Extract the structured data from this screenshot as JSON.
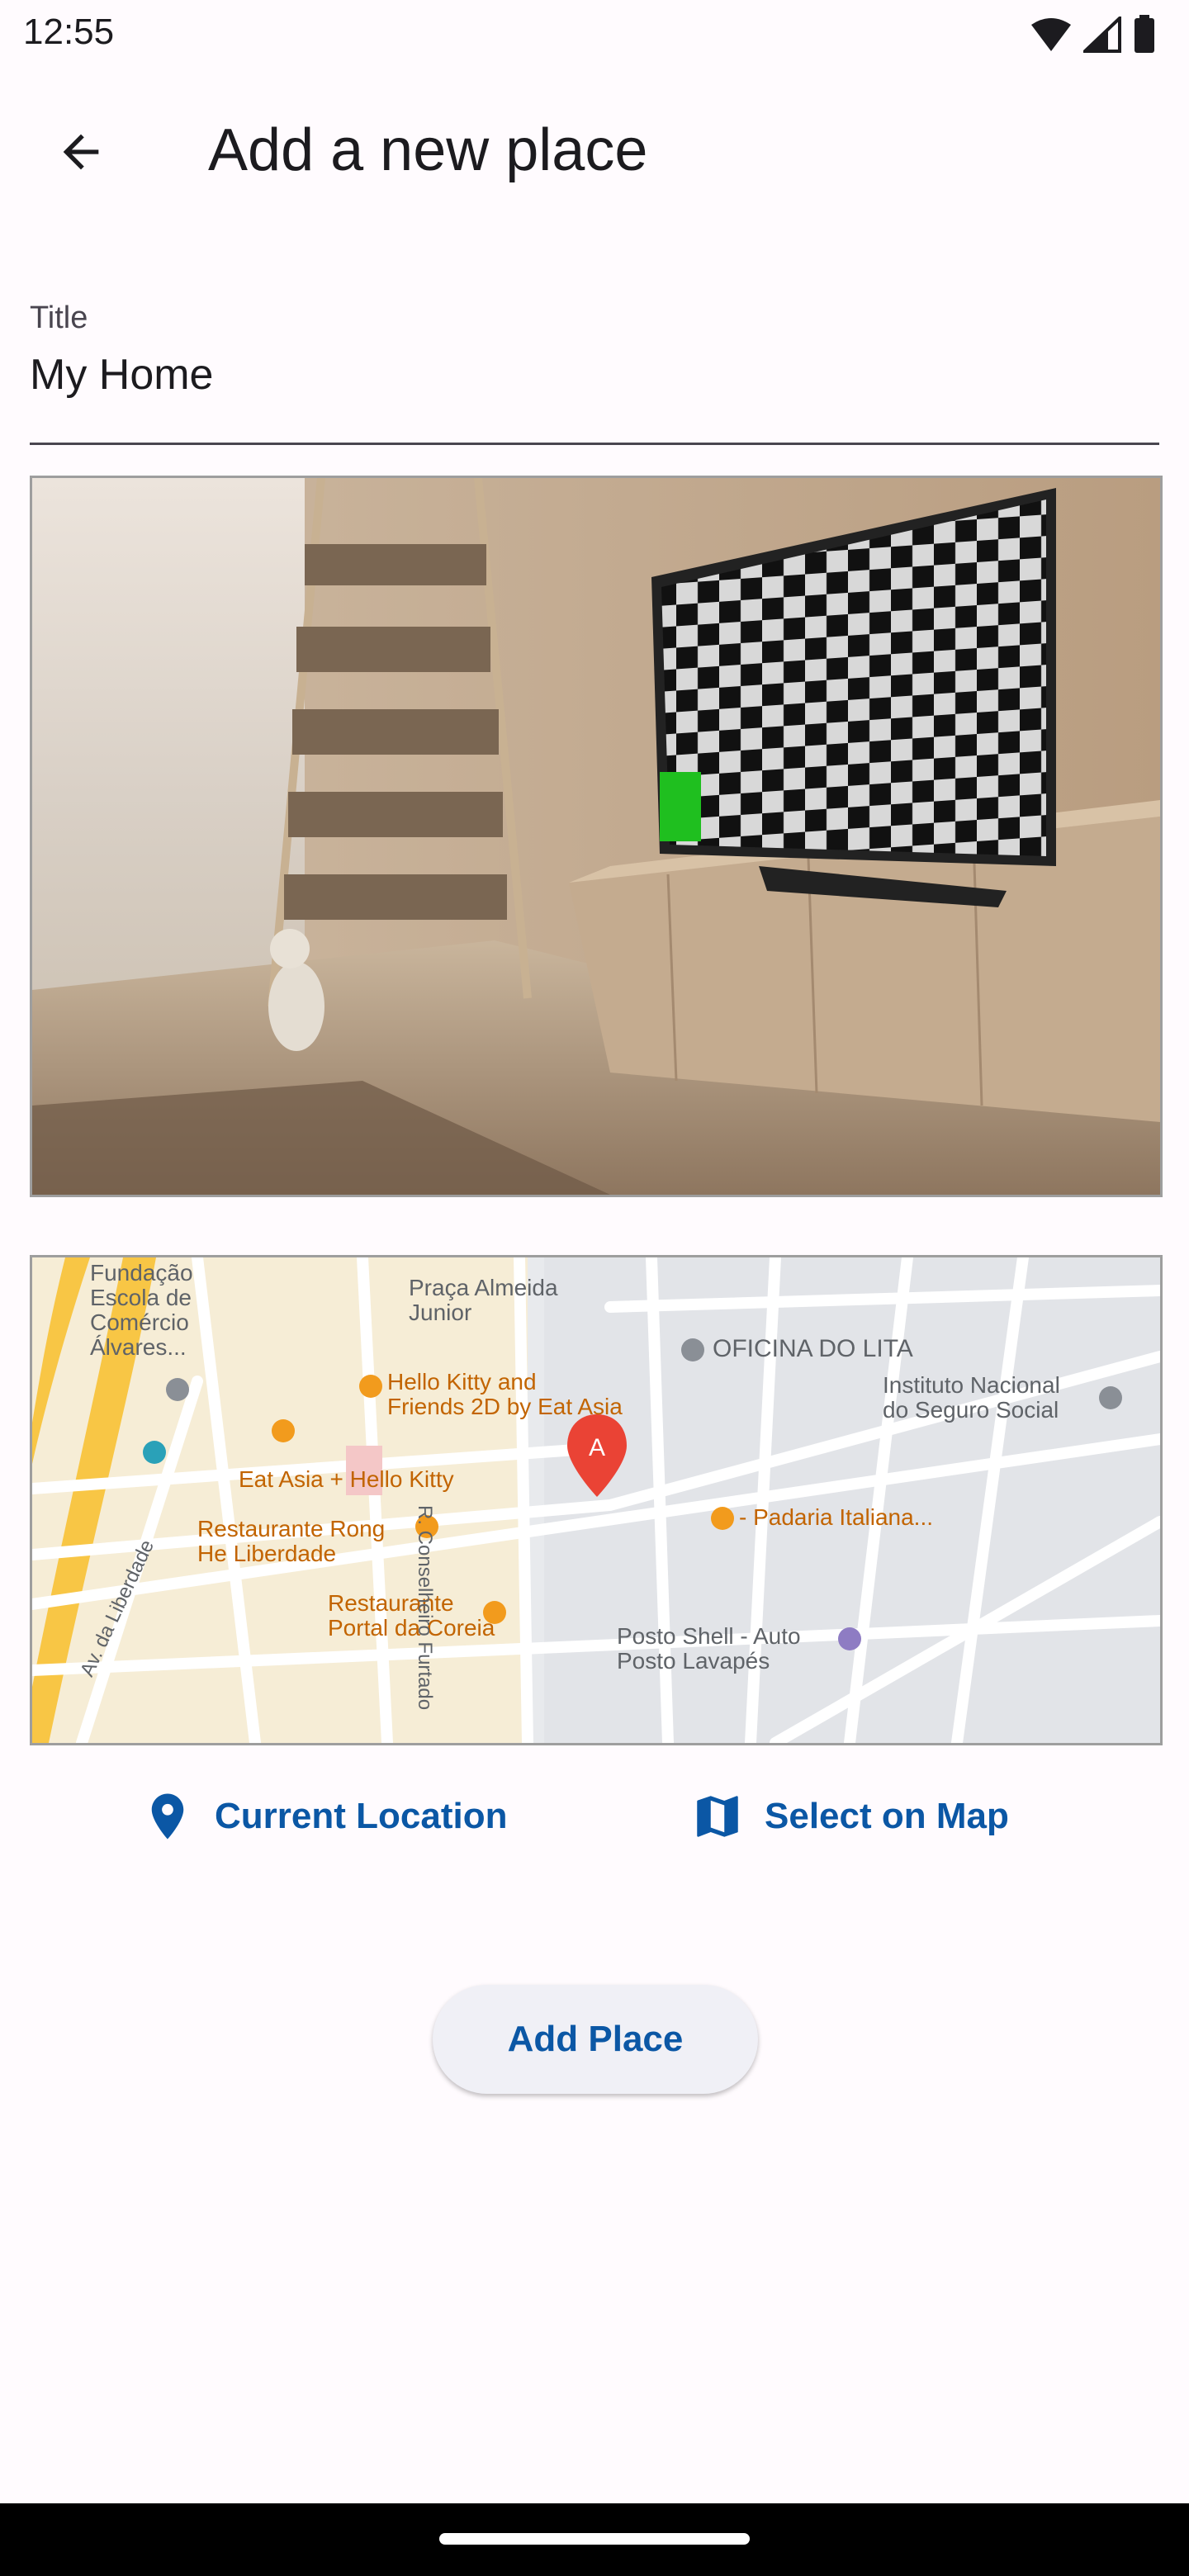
{
  "status_bar": {
    "time": "12:55"
  },
  "app_bar": {
    "title": "Add a new place"
  },
  "form": {
    "title_label": "Title",
    "title_value": "My Home"
  },
  "map": {
    "labels": {
      "fundacao": "Fundação\nEscola de\nComércio\nÁlvares...",
      "praca": "Praça Almeida\nJunior",
      "oficina": "OFICINA DO LITA",
      "hello_kitty": "Hello Kitty and\nFriends 2D by Eat Asia",
      "instituto": "Instituto Nacional\ndo Seguro Social",
      "eat_asia": "Eat Asia + Hello Kitty",
      "rong": "Restaurante Rong\nHe Liberdade",
      "padaria": "- Padaria Italiana...",
      "coreia": "Restaurante\nPortal da Coreia",
      "posto": "Posto Shell - Auto\nPosto Lavapés",
      "conselheiro": "R. Conselheiro Furtado",
      "liberdade": "Av. da Liberdade",
      "marker": "A"
    }
  },
  "actions": {
    "current_location": "Current Location",
    "select_on_map": "Select on Map",
    "add_place": "Add Place"
  },
  "colors": {
    "accent": "#0B57A5",
    "background": "#FFFBFE",
    "marker": "#EA4335"
  }
}
